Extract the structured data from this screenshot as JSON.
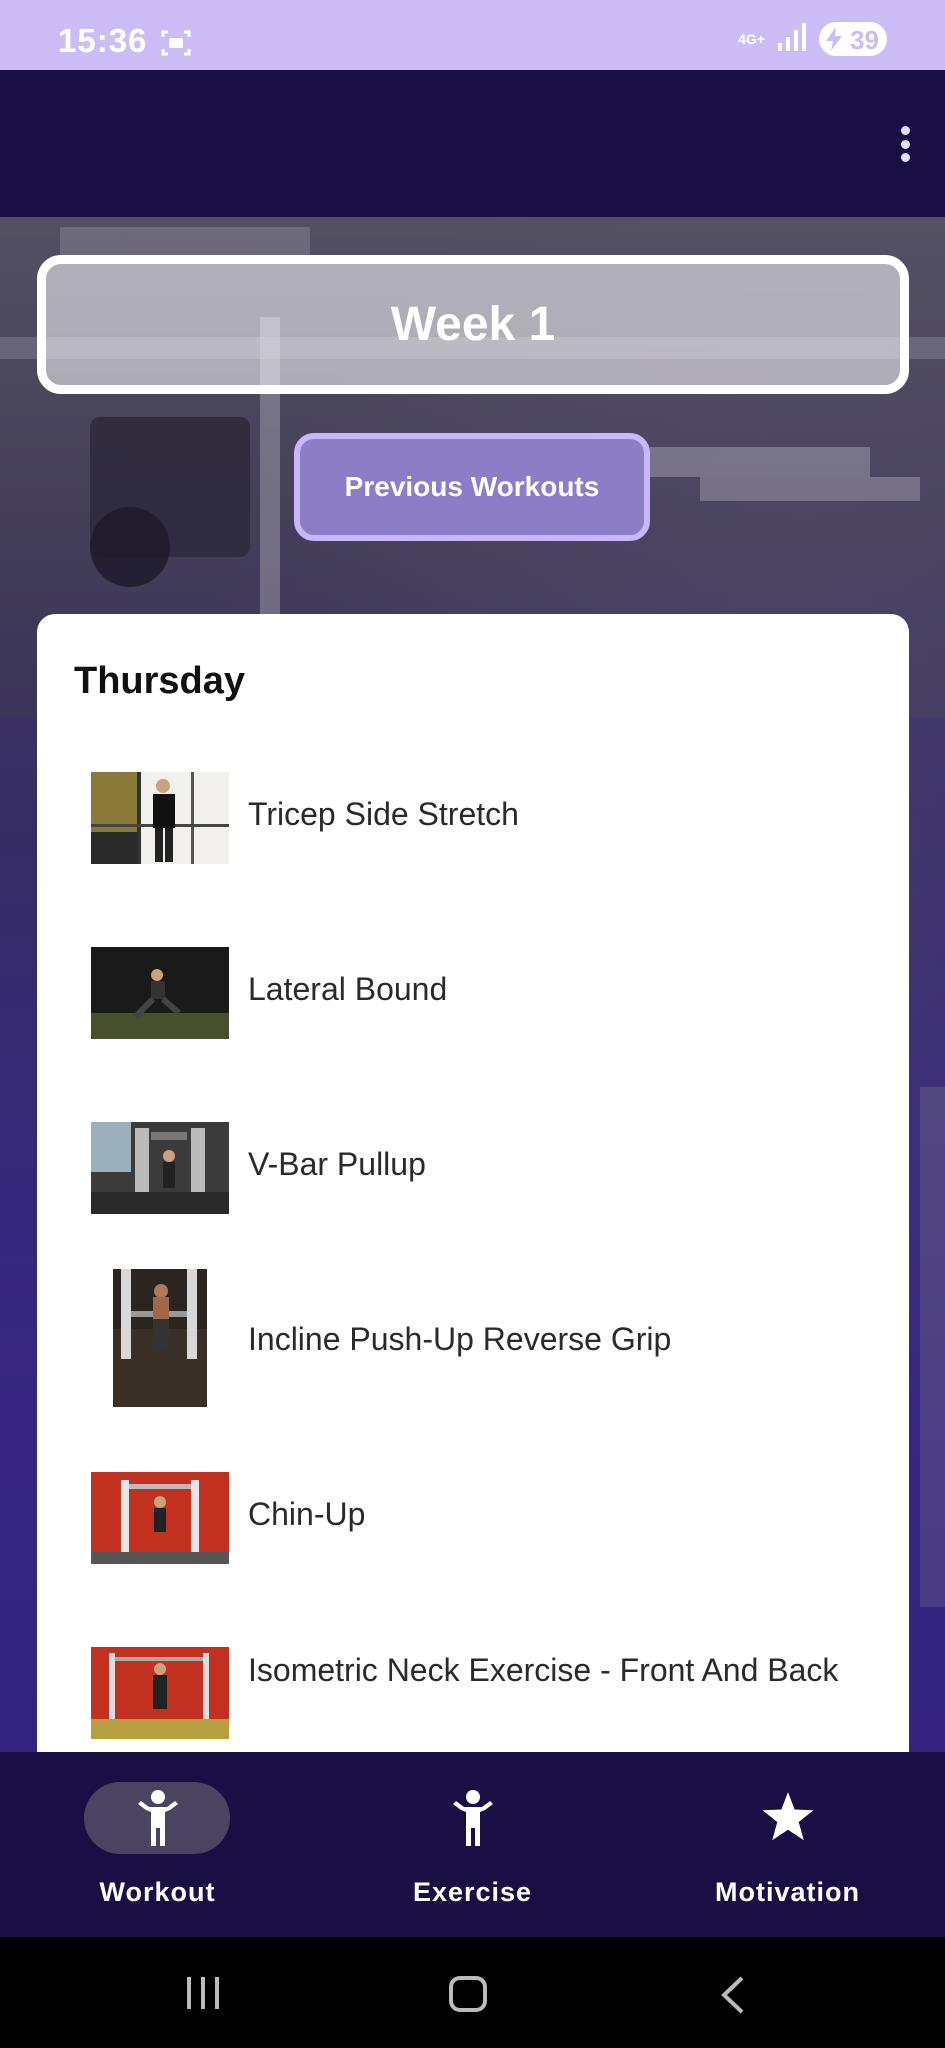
{
  "status_bar": {
    "time": "15:36",
    "network": "4G+",
    "battery": "39"
  },
  "week": {
    "title": "Week 1"
  },
  "previous_button": {
    "label": "Previous Workouts"
  },
  "day": {
    "name": "Thursday",
    "exercises": [
      {
        "label": "Tricep Side Stretch"
      },
      {
        "label": "Lateral Bound"
      },
      {
        "label": "V-Bar Pullup"
      },
      {
        "label": "Incline Push-Up Reverse Grip"
      },
      {
        "label": "Chin-Up"
      },
      {
        "label": "Isometric Neck Exercise - Front And Back"
      }
    ]
  },
  "bottom_nav": {
    "items": [
      {
        "label": "Workout",
        "icon": "person-icon",
        "selected": true
      },
      {
        "label": "Exercise",
        "icon": "person-icon",
        "selected": false
      },
      {
        "label": "Motivation",
        "icon": "star-icon",
        "selected": false
      }
    ]
  },
  "colors": {
    "app_bar": "#1a0f45",
    "status_bar": "#cdbdf7",
    "accent": "#c8b6ff",
    "selected_pill": "#4b4460"
  }
}
